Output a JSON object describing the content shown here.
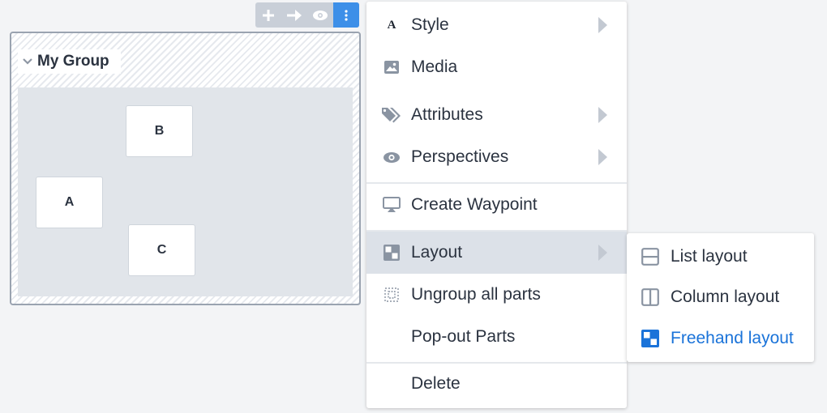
{
  "toolbar": {
    "buttons": [
      {
        "icon": "plus-icon"
      },
      {
        "icon": "arrow-right-icon"
      },
      {
        "icon": "eye-icon"
      },
      {
        "icon": "more-vertical-icon",
        "active": true
      }
    ],
    "active_color": "#3d8fe8"
  },
  "group": {
    "title": "My Group",
    "parts": [
      {
        "label": "B"
      },
      {
        "label": "A"
      },
      {
        "label": "C"
      }
    ]
  },
  "menu": {
    "items": [
      {
        "label": "Style",
        "icon": "style-letter-icon",
        "icon_text": "A",
        "submenu": true
      },
      {
        "label": "Media",
        "icon": "image-icon",
        "submenu": false
      },
      {
        "label": "Attributes",
        "icon": "tags-icon",
        "submenu": true
      },
      {
        "label": "Perspectives",
        "icon": "eye-icon",
        "submenu": true
      },
      {
        "label": "Create Waypoint",
        "icon": "airplay-icon",
        "submenu": false
      },
      {
        "label": "Layout",
        "icon": "layout-icon",
        "submenu": true,
        "highlighted": true
      },
      {
        "label": "Ungroup all parts",
        "icon": "ungroup-icon",
        "submenu": false
      },
      {
        "label": "Pop-out Parts",
        "icon": "",
        "submenu": false
      },
      {
        "label": "Delete",
        "icon": "",
        "submenu": false
      }
    ]
  },
  "layout_submenu": {
    "items": [
      {
        "label": "List layout",
        "icon": "list-layout-icon",
        "selected": false
      },
      {
        "label": "Column layout",
        "icon": "column-layout-icon",
        "selected": false
      },
      {
        "label": "Freehand layout",
        "icon": "freehand-layout-icon",
        "selected": true
      }
    ],
    "selected_color": "#1a73d9"
  }
}
